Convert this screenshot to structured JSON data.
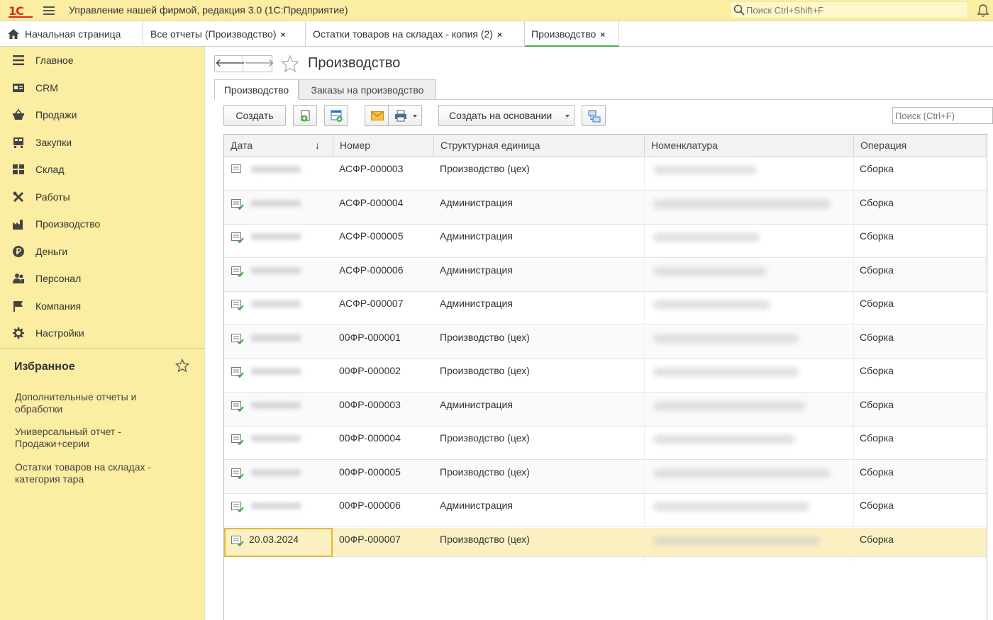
{
  "app": {
    "title": "Управление нашей фирмой, редакция 3.0  (1С:Предприятие)",
    "search_placeholder": "Поиск Ctrl+Shift+F",
    "logo_text": "1С"
  },
  "tabs": [
    {
      "label": "Начальная страница",
      "closable": false
    },
    {
      "label": "Все отчеты (Производство)",
      "closable": true
    },
    {
      "label": "Остатки товаров на складах - копия (2)",
      "closable": true
    },
    {
      "label": "Производство",
      "closable": true,
      "active": true
    }
  ],
  "tab_close_glyph": "×",
  "sidebar": {
    "items": [
      {
        "label": "Главное",
        "icon": "menu-lines-icon"
      },
      {
        "label": "CRM",
        "icon": "id-card-icon"
      },
      {
        "label": "Продажи",
        "icon": "basket-icon"
      },
      {
        "label": "Закупки",
        "icon": "cart-icon"
      },
      {
        "label": "Склад",
        "icon": "warehouse-icon"
      },
      {
        "label": "Работы",
        "icon": "tools-icon"
      },
      {
        "label": "Производство",
        "icon": "factory-icon"
      },
      {
        "label": "Деньги",
        "icon": "ruble-icon"
      },
      {
        "label": "Персонал",
        "icon": "people-icon"
      },
      {
        "label": "Компания",
        "icon": "flag-icon"
      },
      {
        "label": "Настройки",
        "icon": "gear-icon"
      }
    ],
    "favorites_title": "Избранное",
    "favorites": [
      "Дополнительные отчеты и обработки",
      "Универсальный отчет - Продажи+серии",
      "Остатки товаров на складах - категория тара"
    ]
  },
  "main": {
    "title": "Производство",
    "inner_tabs": [
      "Производство",
      "Заказы на производство"
    ],
    "toolbar": {
      "create_label": "Создать",
      "create_based_label": "Создать на основании",
      "search_placeholder": "Поиск (Ctrl+F)"
    },
    "table": {
      "columns": [
        "Дата",
        "Номер",
        "Структурная единица",
        "Номенклатура",
        "Операция"
      ],
      "sort_glyph": "↓",
      "rows": [
        {
          "date": "",
          "number": "АСФР-000003",
          "unit": "Производство (цех)",
          "operation": "Сборка",
          "posted": false
        },
        {
          "date": "",
          "number": "АСФР-000004",
          "unit": "Администрация",
          "operation": "Сборка",
          "posted": true
        },
        {
          "date": "",
          "number": "АСФР-000005",
          "unit": "Администрация",
          "operation": "Сборка",
          "posted": true
        },
        {
          "date": "",
          "number": "АСФР-000006",
          "unit": "Администрация",
          "operation": "Сборка",
          "posted": true
        },
        {
          "date": "",
          "number": "АСФР-000007",
          "unit": "Администрация",
          "operation": "Сборка",
          "posted": true
        },
        {
          "date": "",
          "number": "00ФР-000001",
          "unit": "Производство (цех)",
          "operation": "Сборка",
          "posted": true
        },
        {
          "date": "",
          "number": "00ФР-000002",
          "unit": "Производство (цех)",
          "operation": "Сборка",
          "posted": true
        },
        {
          "date": "",
          "number": "00ФР-000003",
          "unit": "Администрация",
          "operation": "Сборка",
          "posted": true
        },
        {
          "date": "",
          "number": "00ФР-000004",
          "unit": "Производство (цех)",
          "operation": "Сборка",
          "posted": true
        },
        {
          "date": "",
          "number": "00ФР-000005",
          "unit": "Производство (цех)",
          "operation": "Сборка",
          "posted": true
        },
        {
          "date": "",
          "number": "00ФР-000006",
          "unit": "Администрация",
          "operation": "Сборка",
          "posted": true
        },
        {
          "date": "20.03.2024",
          "number": "00ФР-000007",
          "unit": "Производство (цех)",
          "operation": "Сборка",
          "posted": true,
          "selected": true
        }
      ]
    }
  },
  "colors": {
    "panel": "#fbeda1",
    "accent": "#4caf50",
    "logo": "#e1261c",
    "selection": "#fbf0c1",
    "selection_border": "#e4b83b"
  }
}
